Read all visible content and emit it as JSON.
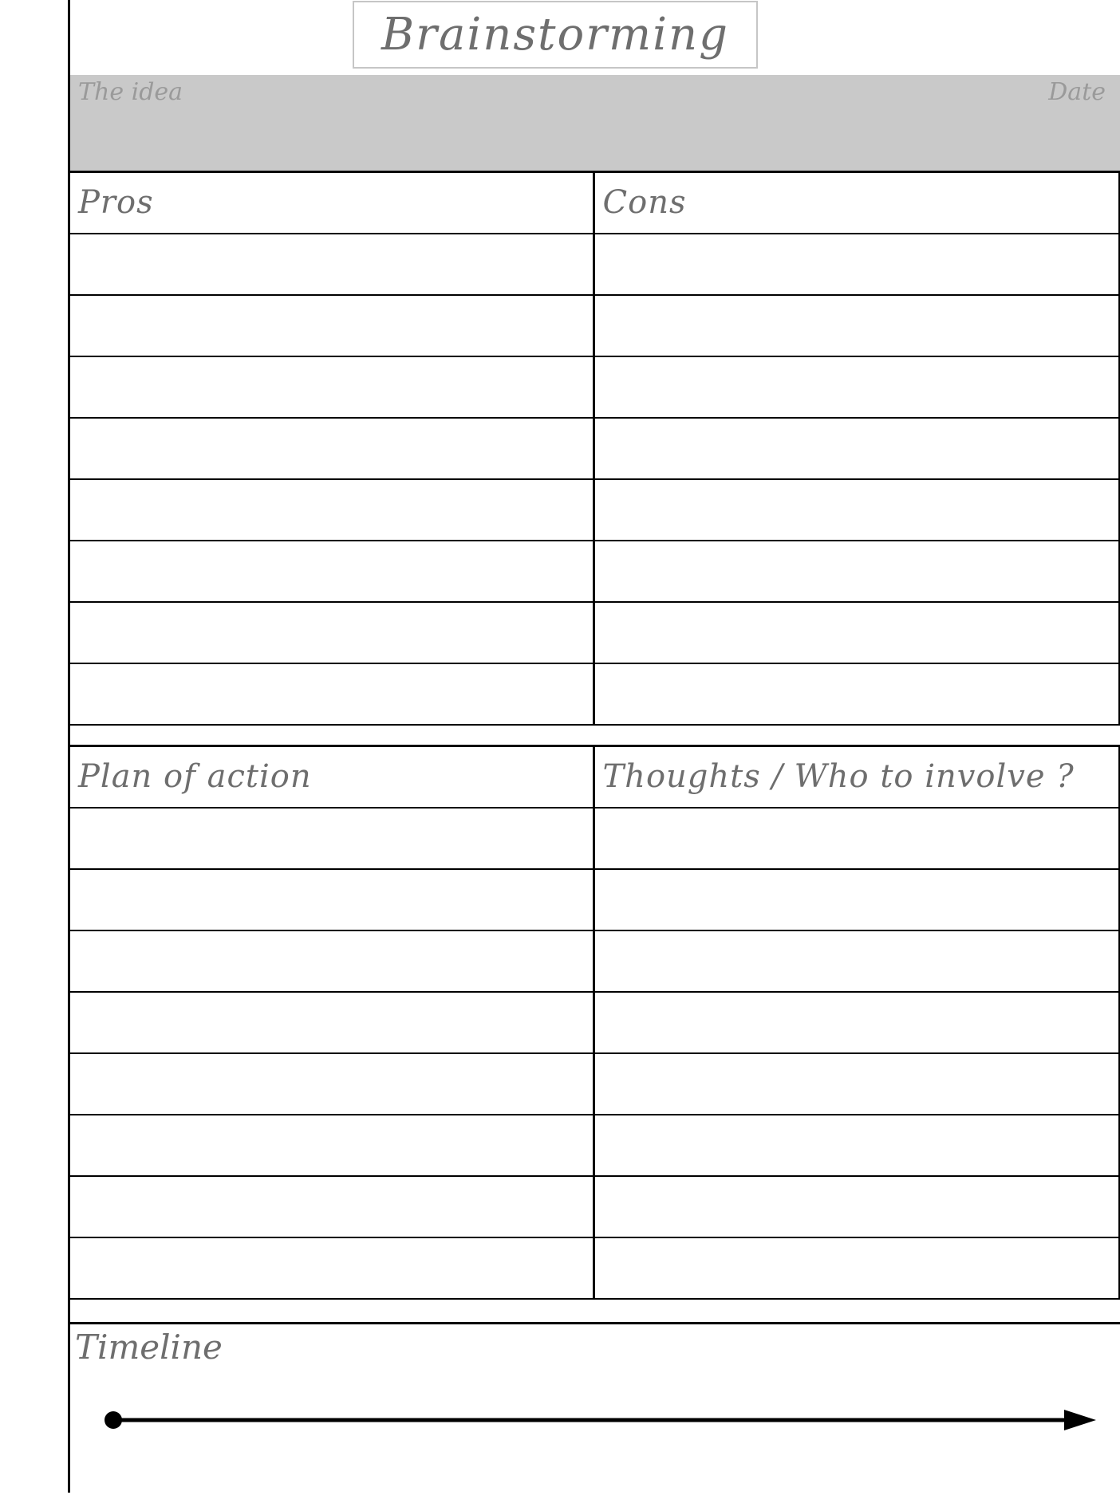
{
  "title": "Brainstorming",
  "idea_bar": {
    "idea_label": "The idea",
    "date_label": "Date"
  },
  "sections": {
    "pros_label": "Pros",
    "cons_label": "Cons",
    "plan_label": "Plan of action",
    "thoughts_label": "Thoughts / Who to involve ?",
    "timeline_label": "Timeline"
  },
  "colors": {
    "label_gray": "#6e6e6e",
    "idea_bar_bg": "#c9c9c9",
    "rule": "#000000"
  }
}
